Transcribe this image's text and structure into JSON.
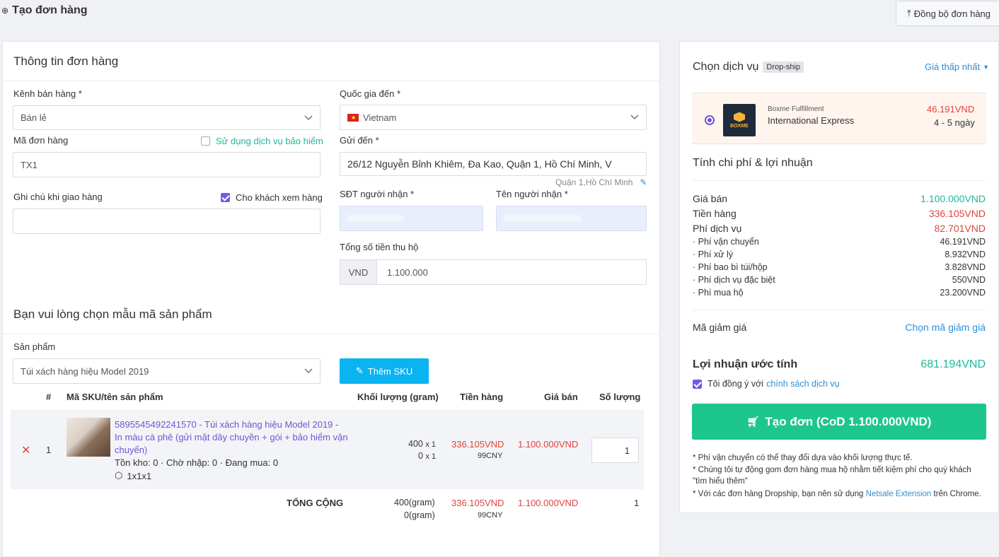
{
  "header": {
    "title": "Tạo đơn hàng",
    "sync_label": "Đồng bộ đơn hàng"
  },
  "order_info": {
    "section_title": "Thông tin đơn hàng",
    "channel_label": "Kênh bán hàng *",
    "channel_value": "Bán lẻ",
    "country_label": "Quốc gia đến *",
    "country_value": "Vietnam",
    "order_code_label": "Mã đơn hàng",
    "insurance_label": "Sử dụng dịch vụ bảo hiểm",
    "order_code_value": "TX1",
    "send_to_label": "Gửi đến *",
    "send_to_value": "26/12 Nguyễn Bỉnh Khiêm, Đa Kao, Quận 1, Hồ Chí Minh, V",
    "district_hint": "Quận 1,Hồ Chí Minh",
    "delivery_note_label": "Ghi chú khi giao hàng",
    "customer_view_label": "Cho khách xem hàng",
    "phone_label": "SĐT người nhận *",
    "receiver_label": "Tên người nhận *",
    "cod_label": "Tổng số tiền thu hộ",
    "cod_currency": "VND",
    "cod_value": "1.100.000"
  },
  "product_section": {
    "title": "Bạn vui lòng chọn mẫu mã sản phẩm",
    "product_label": "Sản phẩm",
    "product_value": "Túi xách hàng hiệu Model 2019",
    "add_sku_label": "Thêm SKU"
  },
  "table": {
    "headers": {
      "index": "#",
      "sku": "Mã SKU/tên sản phẩm",
      "weight": "Khối lượng (gram)",
      "goods": "Tiền hàng",
      "price": "Giá bán",
      "qty": "Số lượng"
    },
    "row": {
      "index": "1",
      "name": "5895545492241570 - Túi xách hàng hiệu Model 2019 - In màu cà phê (gửi mặt dây chuyền + gói + bảo hiểm vận chuyển)",
      "stock": "Tồn kho: 0 · Chờ nhập: 0 · Đang mua: 0",
      "dims": "1x1x1",
      "weight_1": "400",
      "weight_1_mult": "x 1",
      "weight_2": "0",
      "weight_2_mult": "x 1",
      "goods": "336.105VND",
      "goods_cny": "99CNY",
      "price": "1.100.000VND",
      "qty": "1"
    },
    "total": {
      "label": "TỔNG CỘNG",
      "weight_1": "400(gram)",
      "weight_2": "0(gram)",
      "goods": "336.105VND",
      "goods_cny": "99CNY",
      "price": "1.100.000VND",
      "qty": "1"
    }
  },
  "service": {
    "title": "Chọn dịch vụ",
    "badge": "Drop-ship",
    "sort_label": "Giá thấp nhất",
    "provider": "Boxme Fulfillment",
    "provider_logo": "BOXME",
    "name": "International Express",
    "price": "46.191VND",
    "days": "4 - 5 ngày"
  },
  "costs": {
    "title": "Tính chi phí & lợi nhuận",
    "sale_label": "Giá bán",
    "sale_value": "1.100.000VND",
    "goods_label": "Tiền hàng",
    "goods_value": "336.105VND",
    "service_fee_label": "Phí dịch vụ",
    "service_fee_value": "82.701VND",
    "shipping_label": "· Phí vận chuyển",
    "shipping_value": "46.191VND",
    "handling_label": "· Phí xử lý",
    "handling_value": "8.932VND",
    "packaging_label": "· Phí bao bì túi/hộp",
    "packaging_value": "3.828VND",
    "special_label": "· Phí dịch vụ đặc biệt",
    "special_value": "550VND",
    "purchase_label": "· Phí mua hộ",
    "purchase_value": "23.200VND",
    "coupon_label": "Mã giảm giá",
    "coupon_link": "Chọn mã giảm giá",
    "profit_label": "Lợi nhuận ước tính",
    "profit_value": "681.194VND",
    "agree_prefix": "Tôi đồng ý với",
    "agree_link": "chính sách dịch vụ",
    "create_label": "Tạo đơn (CoD 1.100.000VND)",
    "note_1": "* Phí vận chuyển có thể thay đổi dựa vào khối lượng thực tế.",
    "note_2": "* Chúng tôi tự động gom đơn hàng mua hộ nhằm tiết kiệm phí cho quý khách",
    "note_2_link": "\"tìm hiểu thêm\"",
    "note_3_prefix": "* Với các đơn hàng Dropship, bạn nên sử dụng",
    "note_3_link": "Netsale Extension",
    "note_3_suffix": "trên Chrome."
  },
  "colors": {
    "accent_purple": "#6e56cf",
    "teal": "#1fb89a",
    "red": "#e0443e",
    "primary_green": "#1dc68c",
    "sku_blue": "#0ab4f0"
  }
}
